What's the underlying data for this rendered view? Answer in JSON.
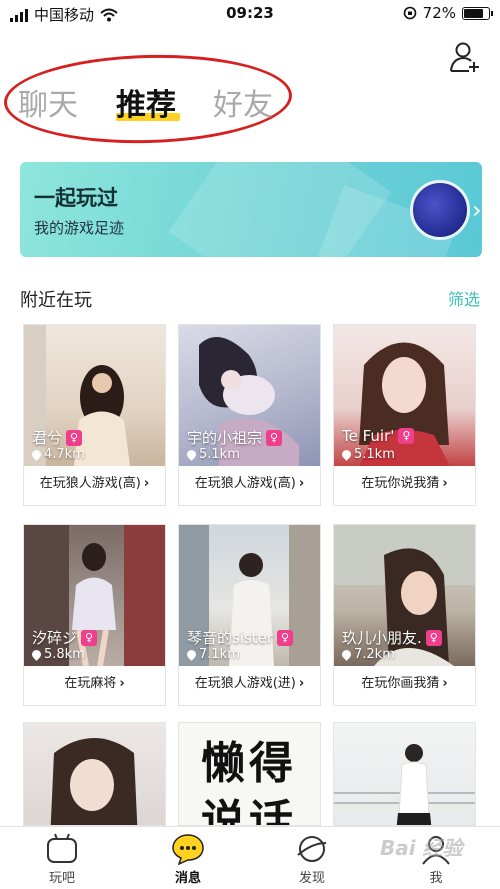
{
  "status_bar": {
    "carrier": "中国移动",
    "time": "09:23",
    "battery": "72%",
    "battery_level": 0.72
  },
  "tabs": [
    {
      "label": "聊天",
      "active": false
    },
    {
      "label": "推荐",
      "active": true
    },
    {
      "label": "好友",
      "active": false
    }
  ],
  "banner": {
    "title": "一起玩过",
    "subtitle": "我的游戏足迹",
    "chevron": "›"
  },
  "nearby": {
    "title": "附近在玩",
    "filter": "筛选"
  },
  "cards": [
    {
      "name": "君兮",
      "distance": "4.7km",
      "status": "在玩狼人游戏(高)",
      "gender": "female"
    },
    {
      "name": "宇的小祖宗",
      "distance": "5.1km",
      "status": "在玩狼人游戏(高)",
      "gender": "female"
    },
    {
      "name": "Te Fuir'",
      "distance": "5.1km",
      "status": "在玩你说我猜",
      "gender": "female"
    },
    {
      "name": "汐碎ジ",
      "distance": "5.8km",
      "status": "在玩麻将",
      "gender": "female"
    },
    {
      "name": "琴音的sister",
      "distance": "7.1km",
      "status": "在玩狼人游戏(进)",
      "gender": "female"
    },
    {
      "name": "玖儿小朋友.",
      "distance": "7.2km",
      "status": "在玩你画我猜",
      "gender": "female"
    }
  ],
  "partial_card_text": "懒得说话",
  "bottom_nav": [
    {
      "label": "玩吧",
      "icon": "play-icon",
      "active": false
    },
    {
      "label": "消息",
      "icon": "message-icon",
      "active": true
    },
    {
      "label": "发现",
      "icon": "discover-icon",
      "active": false
    },
    {
      "label": "我",
      "icon": "profile-icon",
      "active": false
    }
  ],
  "watermark": "Bai 经验",
  "colors": {
    "accent_yellow": "#ffd21f",
    "teal": "#3ac0b5",
    "gender_pink": "#ef3f8c",
    "annotation_red": "#d62020"
  }
}
